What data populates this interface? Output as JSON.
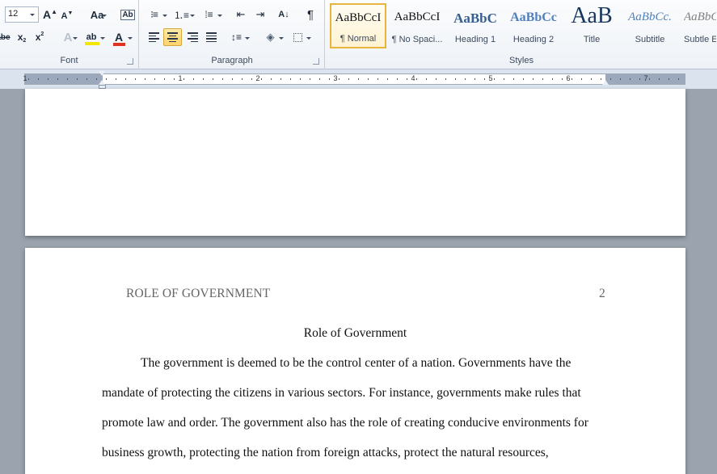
{
  "ribbon": {
    "font_group": {
      "label": "Font",
      "font_size": "12",
      "grow_icon": "A",
      "shrink_icon": "A",
      "change_case": "Aa",
      "strikethrough": "abe",
      "subscript": "x",
      "superscript": "x",
      "text_effects": "A",
      "highlight": "ab",
      "font_color": "A",
      "highlight_color": "#f3e600",
      "font_color_value": "#e0301e"
    },
    "paragraph_group": {
      "label": "Paragraph",
      "show_marks": "¶",
      "sort": "A↓"
    },
    "styles_group": {
      "label": "Styles",
      "items": [
        {
          "sample": "AaBbCcI",
          "name": "¶ Normal"
        },
        {
          "sample": "AaBbCcI",
          "name": "¶ No Spaci..."
        },
        {
          "sample": "AaBbC",
          "name": "Heading 1"
        },
        {
          "sample": "AaBbCc",
          "name": "Heading 2"
        },
        {
          "sample": "AaB",
          "name": "Title"
        },
        {
          "sample": "AaBbCc.",
          "name": "Subtitle"
        },
        {
          "sample": "AaBbCc",
          "name": "Subtle E"
        }
      ]
    }
  },
  "ruler": {
    "numbers": [
      "1",
      "1",
      "2",
      "3",
      "4",
      "5",
      "6",
      "7"
    ]
  },
  "document": {
    "header_text": "ROLE OF GOVERNMENT",
    "page_number": "2",
    "title": "Role of Government",
    "paragraph_lines": [
      "The government is deemed to be the control center of a nation. Governments have the",
      "mandate of protecting the citizens in various sectors. For instance, governments make rules that",
      "promote law and order. The government also has the role of creating conducive environments for",
      "business growth, protecting the nation from foreign attacks, protect the natural resources,"
    ]
  },
  "colors": {
    "accent_selected": "#e8b33f",
    "heading_blue": "#365f91",
    "background": "#9ba3ae"
  }
}
